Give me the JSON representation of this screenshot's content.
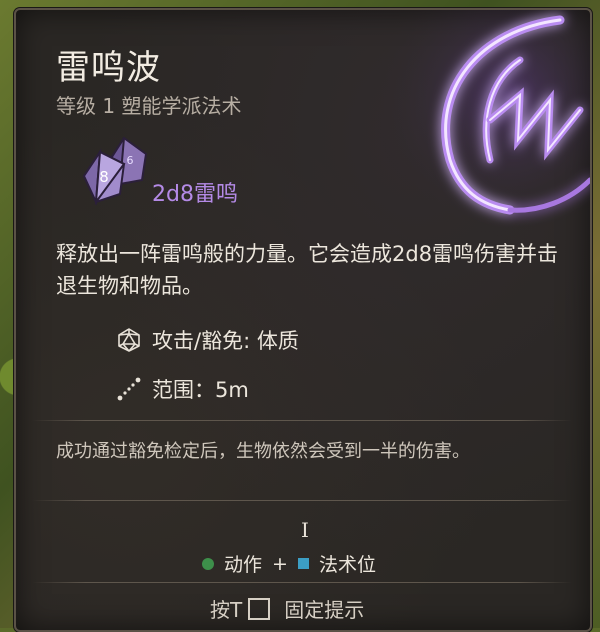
{
  "spell": {
    "name": "雷鸣波",
    "level_school": "等级 1 塑能学派法术",
    "damage_label": "2d8雷鸣",
    "dice_face_number": "8",
    "description": "释放出一阵雷鸣般的力量。它会造成2d8雷鸣伤害并击退生物和物品。",
    "attack_save": "攻击/豁免: 体质",
    "range": "范围：5m",
    "note": "成功通过豁免检定后，生物依然会受到一半的伤害。",
    "cursor_glyph": "I",
    "costs": {
      "action": "动作",
      "plus": "+",
      "spell_slot": "法术位"
    },
    "pin_hint_prefix": "按T",
    "pin_hint_suffix": "固定提示"
  },
  "colors": {
    "panel_bg": "#2a2724",
    "title": "#f2ece2",
    "damage_purple": "#b48ae6",
    "action_green": "#3d8f4a",
    "spell_slot_blue": "#3c9ec4"
  },
  "icons": {
    "spell_art": "thunderwave-art",
    "dice": "d8-dice-icon",
    "attack": "d20-icon",
    "range": "range-dotted-line-icon"
  }
}
